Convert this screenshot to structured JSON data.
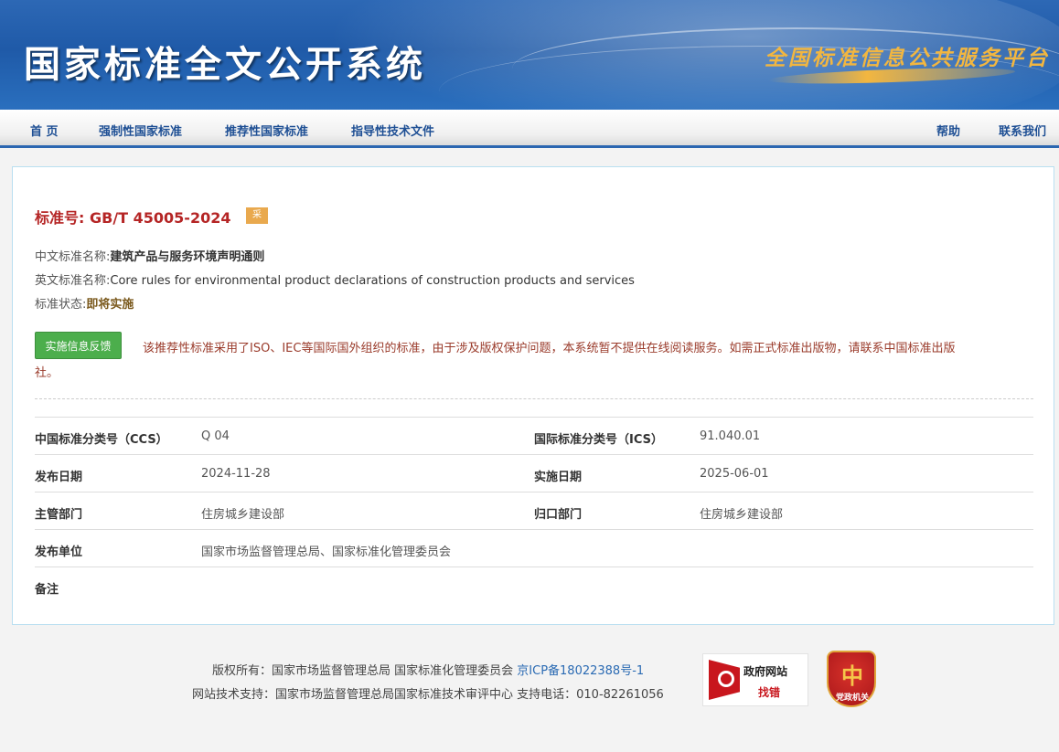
{
  "header": {
    "site_title": "国家标准全文公开系统",
    "platform_title": "全国标准信息公共服务平台"
  },
  "nav": {
    "items": [
      {
        "label": "首 页"
      },
      {
        "label": "强制性国家标准"
      },
      {
        "label": "推荐性国家标准"
      },
      {
        "label": "指导性技术文件"
      }
    ],
    "help": "帮助",
    "contact": "联系我们"
  },
  "standard": {
    "number_label": "标准号:",
    "number": "GB/T 45005-2024",
    "adopt_badge": "采",
    "cn_name_label": "中文标准名称:",
    "cn_name": "建筑产品与服务环境声明通则",
    "en_name_label": "英文标准名称:",
    "en_name": "Core rules for environmental product declarations of construction products and services",
    "status_label": "标准状态:",
    "status": "即将实施",
    "feedback_button": "实施信息反馈",
    "notice": "该推荐性标准采用了ISO、IEC等国际国外组织的标准，由于涉及版权保护问题，本系统暂不提供在线阅读服务。如需正式标准出版物，请联系中国标准出版社。"
  },
  "details": {
    "ccs_label": "中国标准分类号（CCS）",
    "ccs": "Q 04",
    "ics_label": "国际标准分类号（ICS）",
    "ics": "91.040.01",
    "publish_date_label": "发布日期",
    "publish_date": "2024-11-28",
    "impl_date_label": "实施日期",
    "impl_date": "2025-06-01",
    "dept_label": "主管部门",
    "dept": "住房城乡建设部",
    "central_dept_label": "归口部门",
    "central_dept": "住房城乡建设部",
    "publisher_label": "发布单位",
    "publisher": "国家市场监督管理总局、国家标准化管理委员会",
    "remarks_label": "备注",
    "remarks": ""
  },
  "footer": {
    "copyright": "版权所有：国家市场监督管理总局 国家标准化管理委员会",
    "icp": "京ICP备18022388号-1",
    "support": "网站技术支持：国家市场监督管理总局国家标准技术审评中心 支持电话：010-82261056",
    "gov_badge_line1": "政府网站",
    "gov_badge_line2": "找错",
    "party_badge_glyph": "中",
    "party_badge_text": "党政机关"
  }
}
